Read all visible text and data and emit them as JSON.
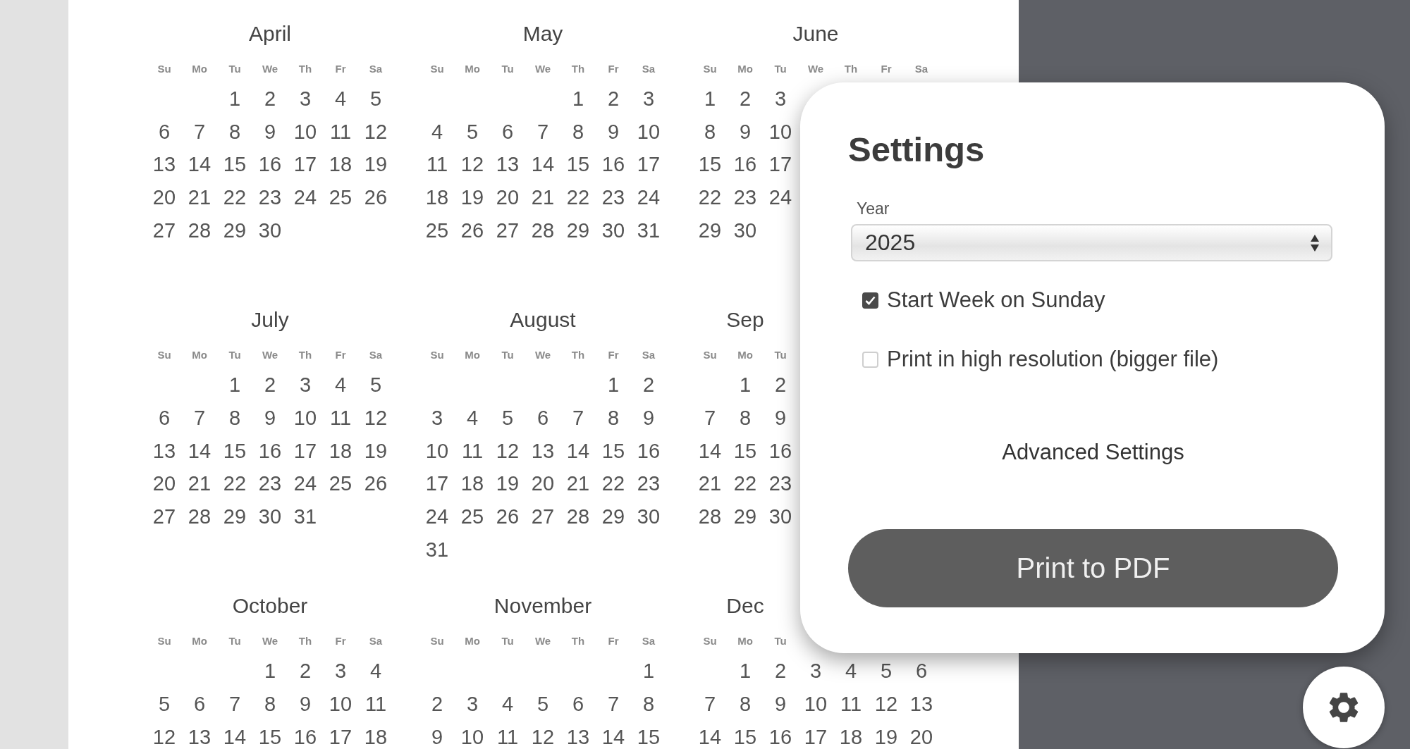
{
  "calendar": {
    "months": [
      {
        "title": "April",
        "weekdays": [
          "Su",
          "Mo",
          "Tu",
          "We",
          "Th",
          "Fr",
          "Sa"
        ],
        "weeks": [
          [
            {
              "kind": "blank"
            },
            {
              "kind": "blank"
            },
            "1",
            "2",
            "3",
            "4",
            "5"
          ],
          [
            "6",
            "7",
            "8",
            "9",
            "10",
            "11",
            "12"
          ],
          [
            "13",
            "14",
            "15",
            "16",
            "17",
            "18",
            "19"
          ],
          [
            "20",
            "21",
            "22",
            "23",
            "24",
            "25",
            "26"
          ],
          [
            "27",
            "28",
            "29",
            "30"
          ]
        ]
      },
      {
        "title": "May",
        "weekdays": [
          "Su",
          "Mo",
          "Tu",
          "We",
          "Th",
          "Fr",
          "Sa"
        ],
        "weeks": [
          [
            {
              "kind": "blank"
            },
            {
              "kind": "blank"
            },
            {
              "kind": "blank"
            },
            {
              "kind": "blank"
            },
            "1",
            "2",
            "3"
          ],
          [
            "4",
            "5",
            "6",
            "7",
            "8",
            "9",
            "10"
          ],
          [
            "11",
            "12",
            "13",
            "14",
            "15",
            "16",
            "17"
          ],
          [
            "18",
            "19",
            "20",
            "21",
            "22",
            "23",
            "24"
          ],
          [
            "25",
            "26",
            "27",
            "28",
            "29",
            "30",
            "31"
          ]
        ]
      },
      {
        "title": "June",
        "weekdays": [
          "Su",
          "Mo",
          "Tu",
          "We",
          "Th",
          "Fr",
          "Sa"
        ],
        "weeks": [
          [
            "1",
            "2",
            "3"
          ],
          [
            "8",
            "9",
            "10"
          ],
          [
            "15",
            "16",
            "17"
          ],
          [
            "22",
            "23",
            "24"
          ],
          [
            "29",
            "30"
          ]
        ]
      },
      {
        "title": "July",
        "weekdays": [
          "Su",
          "Mo",
          "Tu",
          "We",
          "Th",
          "Fr",
          "Sa"
        ],
        "weeks": [
          [
            {
              "kind": "blank"
            },
            {
              "kind": "blank"
            },
            "1",
            "2",
            "3",
            "4",
            "5"
          ],
          [
            "6",
            "7",
            "8",
            "9",
            "10",
            "11",
            "12"
          ],
          [
            "13",
            "14",
            "15",
            "16",
            "17",
            "18",
            "19"
          ],
          [
            "20",
            "21",
            "22",
            "23",
            "24",
            "25",
            "26"
          ],
          [
            "27",
            "28",
            "29",
            "30",
            "31"
          ]
        ]
      },
      {
        "title": "August",
        "weekdays": [
          "Su",
          "Mo",
          "Tu",
          "We",
          "Th",
          "Fr",
          "Sa"
        ],
        "weeks": [
          [
            {
              "kind": "blank"
            },
            {
              "kind": "blank"
            },
            {
              "kind": "blank"
            },
            {
              "kind": "blank"
            },
            {
              "kind": "blank"
            },
            "1",
            "2"
          ],
          [
            "3",
            "4",
            "5",
            "6",
            "7",
            "8",
            "9"
          ],
          [
            "10",
            "11",
            "12",
            "13",
            "14",
            "15",
            "16"
          ],
          [
            "17",
            "18",
            "19",
            "20",
            "21",
            "22",
            "23"
          ],
          [
            "24",
            "25",
            "26",
            "27",
            "28",
            "29",
            "30"
          ],
          [
            "31"
          ]
        ]
      },
      {
        "title": "Sep",
        "weekdays": [
          "Su",
          "Mo",
          "Tu"
        ],
        "weeks": [
          [
            {
              "kind": "blank"
            },
            "1",
            "2"
          ],
          [
            "7",
            "8",
            "9"
          ],
          [
            "14",
            "15",
            "16"
          ],
          [
            "21",
            "22",
            "23"
          ],
          [
            "28",
            "29",
            "30"
          ]
        ]
      },
      {
        "title": "October",
        "weekdays": [
          "Su",
          "Mo",
          "Tu",
          "We",
          "Th",
          "Fr",
          "Sa"
        ],
        "weeks": [
          [
            {
              "kind": "blank"
            },
            {
              "kind": "blank"
            },
            {
              "kind": "blank"
            },
            "1",
            "2",
            "3",
            "4"
          ],
          [
            "5",
            "6",
            "7",
            "8",
            "9",
            "10",
            "11"
          ],
          [
            "12",
            "13",
            "14",
            "15",
            "16",
            "17",
            "18"
          ]
        ]
      },
      {
        "title": "November",
        "weekdays": [
          "Su",
          "Mo",
          "Tu",
          "We",
          "Th",
          "Fr",
          "Sa"
        ],
        "weeks": [
          [
            {
              "kind": "blank"
            },
            {
              "kind": "blank"
            },
            {
              "kind": "blank"
            },
            {
              "kind": "blank"
            },
            {
              "kind": "blank"
            },
            {
              "kind": "blank"
            },
            "1"
          ],
          [
            "2",
            "3",
            "4",
            "5",
            "6",
            "7",
            "8"
          ],
          [
            "9",
            "10",
            "11",
            "12",
            "13",
            "14",
            "15"
          ]
        ]
      },
      {
        "title": "Dec",
        "weekdays": [
          "Su",
          "Mo",
          "Tu"
        ],
        "weeks": [
          [
            {
              "kind": "blank"
            },
            "1",
            "2",
            "3",
            "4",
            "5",
            "6"
          ],
          [
            "7",
            "8",
            "9",
            "10",
            "11",
            "12",
            "13"
          ],
          [
            "14",
            "15",
            "16",
            "17",
            "18",
            "19",
            "20"
          ]
        ]
      }
    ]
  },
  "settings": {
    "title": "Settings",
    "year_field": {
      "label": "Year",
      "value": "2025"
    },
    "options": [
      {
        "label": "Start Week on Sunday",
        "checked": true
      },
      {
        "label": "Print in high resolution (bigger file)",
        "checked": false
      }
    ],
    "advanced_link": "Advanced Settings",
    "print_button": "Print to PDF"
  }
}
